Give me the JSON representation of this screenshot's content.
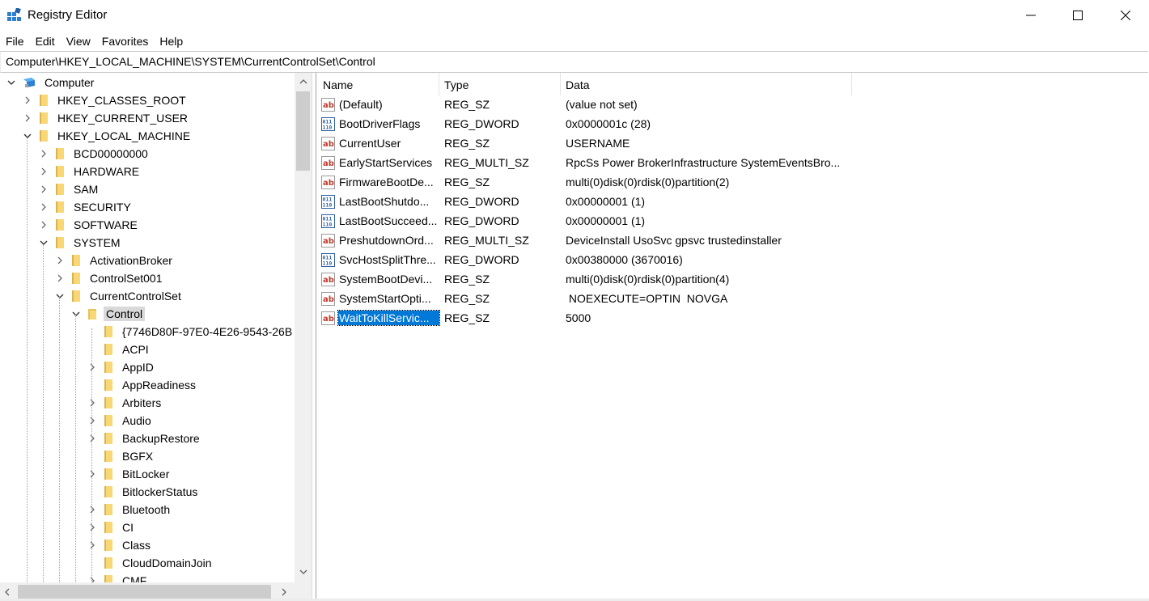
{
  "window": {
    "title": "Registry Editor"
  },
  "menu": [
    "File",
    "Edit",
    "View",
    "Favorites",
    "Help"
  ],
  "address": "Computer\\HKEY_LOCAL_MACHINE\\SYSTEM\\CurrentControlSet\\Control",
  "tree": [
    {
      "label": "Computer",
      "level": 0,
      "expander": "expanded",
      "icon": "computer-icon"
    },
    {
      "label": "HKEY_CLASSES_ROOT",
      "level": 1,
      "expander": "collapsed",
      "icon": "folder-icon"
    },
    {
      "label": "HKEY_CURRENT_USER",
      "level": 1,
      "expander": "collapsed",
      "icon": "folder-icon"
    },
    {
      "label": "HKEY_LOCAL_MACHINE",
      "level": 1,
      "expander": "expanded",
      "icon": "folder-icon"
    },
    {
      "label": "BCD00000000",
      "level": 2,
      "expander": "collapsed",
      "icon": "folder-icon"
    },
    {
      "label": "HARDWARE",
      "level": 2,
      "expander": "collapsed",
      "icon": "folder-icon"
    },
    {
      "label": "SAM",
      "level": 2,
      "expander": "collapsed",
      "icon": "folder-icon"
    },
    {
      "label": "SECURITY",
      "level": 2,
      "expander": "collapsed",
      "icon": "folder-icon"
    },
    {
      "label": "SOFTWARE",
      "level": 2,
      "expander": "collapsed",
      "icon": "folder-icon"
    },
    {
      "label": "SYSTEM",
      "level": 2,
      "expander": "expanded",
      "icon": "folder-icon"
    },
    {
      "label": "ActivationBroker",
      "level": 3,
      "expander": "collapsed",
      "icon": "folder-icon"
    },
    {
      "label": "ControlSet001",
      "level": 3,
      "expander": "collapsed",
      "icon": "folder-icon"
    },
    {
      "label": "CurrentControlSet",
      "level": 3,
      "expander": "expanded",
      "icon": "folder-icon"
    },
    {
      "label": "Control",
      "level": 4,
      "expander": "expanded",
      "icon": "folder-open-icon",
      "selected": true
    },
    {
      "label": "{7746D80F-97E0-4E26-9543-26B",
      "level": 5,
      "expander": "none",
      "icon": "folder-icon"
    },
    {
      "label": "ACPI",
      "level": 5,
      "expander": "none",
      "icon": "folder-icon"
    },
    {
      "label": "AppID",
      "level": 5,
      "expander": "collapsed",
      "icon": "folder-icon"
    },
    {
      "label": "AppReadiness",
      "level": 5,
      "expander": "none",
      "icon": "folder-icon"
    },
    {
      "label": "Arbiters",
      "level": 5,
      "expander": "collapsed",
      "icon": "folder-icon"
    },
    {
      "label": "Audio",
      "level": 5,
      "expander": "collapsed",
      "icon": "folder-icon"
    },
    {
      "label": "BackupRestore",
      "level": 5,
      "expander": "collapsed",
      "icon": "folder-icon"
    },
    {
      "label": "BGFX",
      "level": 5,
      "expander": "none",
      "icon": "folder-icon"
    },
    {
      "label": "BitLocker",
      "level": 5,
      "expander": "collapsed",
      "icon": "folder-icon"
    },
    {
      "label": "BitlockerStatus",
      "level": 5,
      "expander": "none",
      "icon": "folder-icon"
    },
    {
      "label": "Bluetooth",
      "level": 5,
      "expander": "collapsed",
      "icon": "folder-icon"
    },
    {
      "label": "CI",
      "level": 5,
      "expander": "collapsed",
      "icon": "folder-icon"
    },
    {
      "label": "Class",
      "level": 5,
      "expander": "collapsed",
      "icon": "folder-icon"
    },
    {
      "label": "CloudDomainJoin",
      "level": 5,
      "expander": "none",
      "icon": "folder-icon"
    },
    {
      "label": "CMF",
      "level": 5,
      "expander": "collapsed",
      "icon": "folder-icon"
    }
  ],
  "columns": {
    "name": "Name",
    "type": "Type",
    "data": "Data"
  },
  "values": [
    {
      "name": "(Default)",
      "type": "REG_SZ",
      "data": "(value not set)",
      "icon": "string-value-icon"
    },
    {
      "name": "BootDriverFlags",
      "type": "REG_DWORD",
      "data": "0x0000001c (28)",
      "icon": "binary-value-icon"
    },
    {
      "name": "CurrentUser",
      "type": "REG_SZ",
      "data": "USERNAME",
      "icon": "string-value-icon"
    },
    {
      "name": "EarlyStartServices",
      "type": "REG_MULTI_SZ",
      "data": "RpcSs Power BrokerInfrastructure SystemEventsBro...",
      "icon": "string-value-icon"
    },
    {
      "name": "FirmwareBootDe...",
      "type": "REG_SZ",
      "data": "multi(0)disk(0)rdisk(0)partition(2)",
      "icon": "string-value-icon"
    },
    {
      "name": "LastBootShutdo...",
      "type": "REG_DWORD",
      "data": "0x00000001 (1)",
      "icon": "binary-value-icon"
    },
    {
      "name": "LastBootSucceed...",
      "type": "REG_DWORD",
      "data": "0x00000001 (1)",
      "icon": "binary-value-icon"
    },
    {
      "name": "PreshutdownOrd...",
      "type": "REG_MULTI_SZ",
      "data": "DeviceInstall UsoSvc gpsvc trustedinstaller",
      "icon": "string-value-icon"
    },
    {
      "name": "SvcHostSplitThre...",
      "type": "REG_DWORD",
      "data": "0x00380000 (3670016)",
      "icon": "binary-value-icon"
    },
    {
      "name": "SystemBootDevi...",
      "type": "REG_SZ",
      "data": "multi(0)disk(0)rdisk(0)partition(4)",
      "icon": "string-value-icon"
    },
    {
      "name": "SystemStartOpti...",
      "type": "REG_SZ",
      "data": " NOEXECUTE=OPTIN  NOVGA",
      "icon": "string-value-icon"
    },
    {
      "name": "WaitToKillServic...",
      "type": "REG_SZ",
      "data": "5000",
      "icon": "string-value-icon",
      "selected": true
    }
  ]
}
